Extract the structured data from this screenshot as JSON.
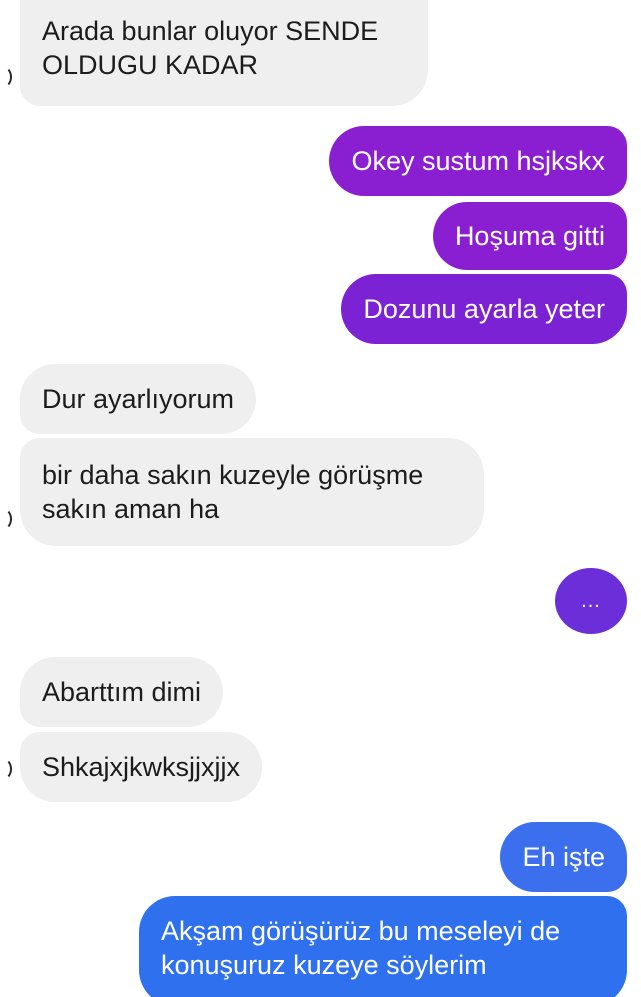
{
  "colors": {
    "incoming_bubble": "#efefef",
    "outgoing_purple": "#8a1fd1",
    "outgoing_violet": "#6c2ed9",
    "outgoing_blue": "#3b6fee"
  },
  "messages": {
    "m1": "Arada bunlar oluyor SENDE\nOLDUGU KADAR",
    "m2": "Okey sustum hsjkskx",
    "m3": "Hoşuma gitti",
    "m4": "Dozunu ayarla yeter",
    "m5": "Dur ayarlıyorum",
    "m6": "bir daha sakın kuzeyle görüşme\nsakın aman ha",
    "m7": "...",
    "m8": "Abarttım dimi",
    "m9": "Shkajxjkwksjjxjjx",
    "m10": "Eh işte",
    "m11": "Akşam görüşürüz bu meseleyi de\nkonuşuruz kuzeye söylerim"
  }
}
